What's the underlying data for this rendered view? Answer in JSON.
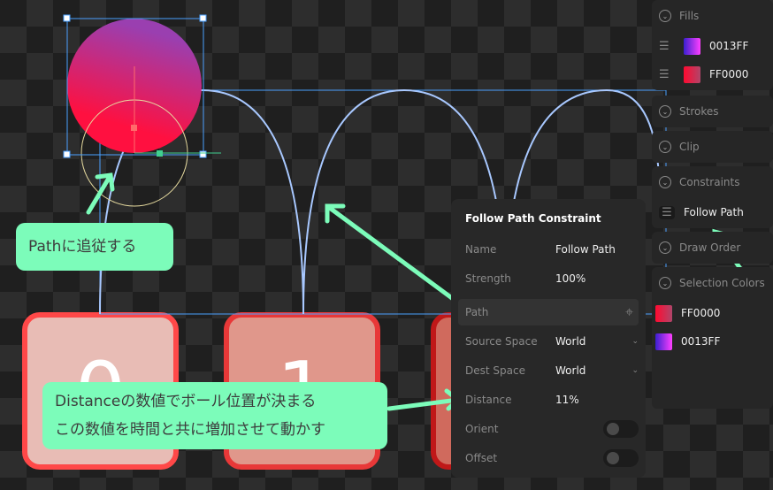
{
  "canvas": {
    "boxes": [
      {
        "label": "0",
        "fill": "#e8bcb5"
      },
      {
        "label": "1",
        "fill": "#e0978b"
      },
      {
        "label": "",
        "fill": "#d06a5d"
      }
    ],
    "ball_gradient": [
      "#ff1040",
      "#9a3fb0"
    ]
  },
  "callouts": {
    "path_note": "Pathに追従する",
    "distance_line1": "Distanceの数値でボール位置が決まる",
    "distance_line2": "この数値を時間と共に増加させて動かす"
  },
  "sidebar": {
    "fills": {
      "title": "Fills",
      "items": [
        {
          "label": "0013FF",
          "colors": [
            "#3a1fd0",
            "#ff40ff"
          ]
        },
        {
          "label": "FF0000",
          "colors": [
            "#ff0a30",
            "#b0456a"
          ]
        }
      ]
    },
    "strokes": {
      "title": "Strokes"
    },
    "clip": {
      "title": "Clip"
    },
    "constraints": {
      "title": "Constraints",
      "items": [
        {
          "label": "Follow Path"
        }
      ]
    },
    "draw_order": {
      "title": "Draw Order"
    },
    "selection_colors": {
      "title": "Selection Colors",
      "items": [
        {
          "label": "FF0000",
          "colors": [
            "#ff0a30",
            "#b0456a"
          ]
        },
        {
          "label": "0013FF",
          "colors": [
            "#3a1fd0",
            "#ff40ff"
          ]
        }
      ]
    }
  },
  "popover": {
    "title": "Follow Path Constraint",
    "name": {
      "label": "Name",
      "value": "Follow Path"
    },
    "strength": {
      "label": "Strength",
      "value": "100%"
    },
    "path": {
      "label": "Path"
    },
    "source_space": {
      "label": "Source Space",
      "value": "World"
    },
    "dest_space": {
      "label": "Dest Space",
      "value": "World"
    },
    "distance": {
      "label": "Distance",
      "value": "11%"
    },
    "orient": {
      "label": "Orient",
      "on": false
    },
    "offset": {
      "label": "Offset",
      "on": false
    }
  },
  "accent": "#7cfcba"
}
